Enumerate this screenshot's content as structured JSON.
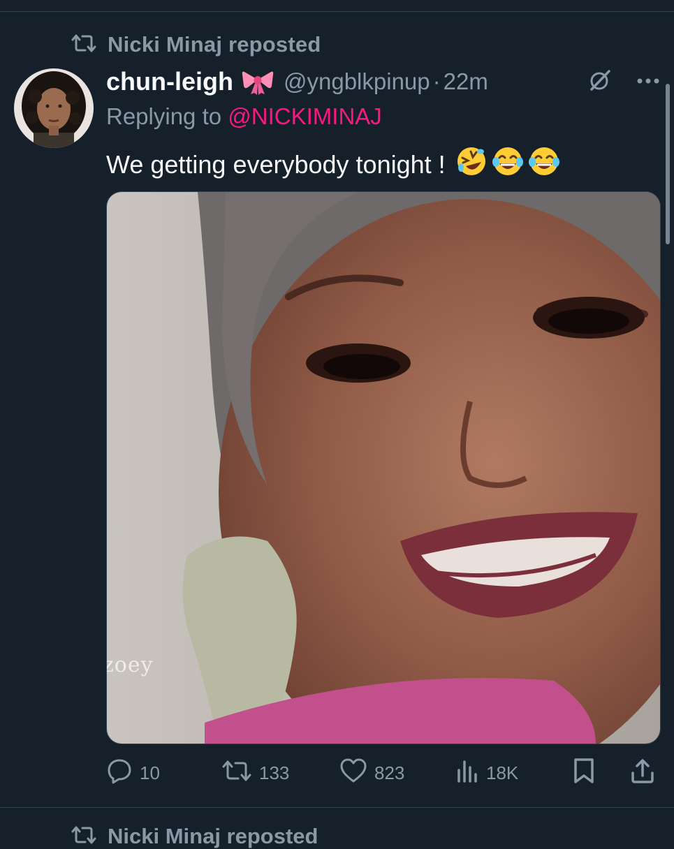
{
  "repost_header": {
    "icon": "repost-icon",
    "label": "Nicki Minaj reposted"
  },
  "tweet": {
    "display_name": "chun-leigh",
    "name_emoji": "ribbon-bow",
    "handle": "@yngblkpinup",
    "separator": "·",
    "time": "22m",
    "header_icons": [
      "grok-icon",
      "more-icon"
    ],
    "replying_prefix": "Replying to",
    "replying_to": "@NICKIMINAJ",
    "text": "We getting everybody tonight !",
    "text_emojis": [
      "rolling-on-floor-laughing",
      "face-with-tears-of-joy",
      "face-with-tears-of-joy"
    ],
    "media_watermark": "zoey"
  },
  "actions": {
    "replies": "10",
    "reposts": "133",
    "likes": "823",
    "views": "18K"
  },
  "next_item": {
    "label": "Nicki Minaj reposted"
  },
  "colors": {
    "background": "#15202b",
    "text": "#f7f9f9",
    "muted": "#8b98a5",
    "mention": "#f91880",
    "divider": "#38444d"
  }
}
